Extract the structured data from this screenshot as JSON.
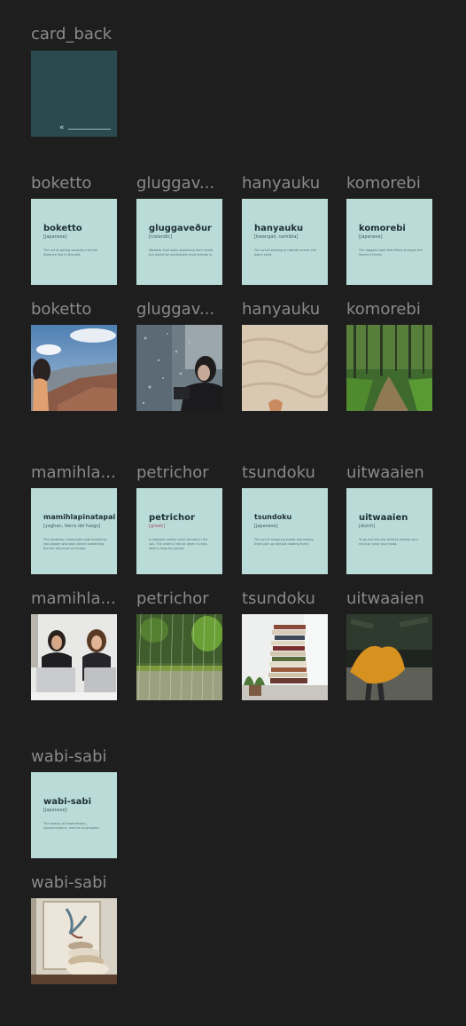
{
  "card_back": {
    "label": "card_back",
    "arrow": "«"
  },
  "rows": [
    {
      "labels": [
        "boketto",
        "gluggav...",
        "hanyauku",
        "komorebi"
      ],
      "cards": [
        {
          "word": "boketto",
          "origin": "[japanese]",
          "desc": "The act of gazing vacantly into the distance lost in thought."
        },
        {
          "word": "gluggaveður",
          "origin": "[icelandic]",
          "desc": "Weather that looks appealing from inside but would be unpleasant once outside in."
        },
        {
          "word": "hanyauku",
          "origin": "[kwangali, namibia]",
          "desc": "The act of walking on tiptoes across the warm sand."
        },
        {
          "word": "komorebi",
          "origin": "[japanese]",
          "desc": "The dappled light that filters through the leaves of trees."
        }
      ],
      "photo_labels": [
        "boketto",
        "gluggav...",
        "hanyauku",
        "komorebi"
      ]
    },
    {
      "labels": [
        "mamihla...",
        "petrichor",
        "tsundoku",
        "uitwaaien"
      ],
      "cards": [
        {
          "word": "mamihlapinatapai",
          "origin": "[yaghan, tierra del fuego]",
          "desc": "The wordless, meaningful look shared by two people who both desire something but are reluctant to initiate."
        },
        {
          "word": "petrichor",
          "origin": "[greek]",
          "desc": "A pleasant earthy scent formed in the soil. The smell in the air when it rains after a long dry period."
        },
        {
          "word": "tsundoku",
          "origin": "[japanese]",
          "desc": "The act of acquiring books and letting them pile up without reading them."
        },
        {
          "word": "uitwaaien",
          "origin": "[dutch]",
          "desc": "To go out into the wind to refresh your mind or clear your head."
        }
      ],
      "photo_labels": [
        "mamihla...",
        "petrichor",
        "tsundoku",
        "uitwaaien"
      ]
    },
    {
      "labels": [
        "wabi-sabi"
      ],
      "cards": [
        {
          "word": "wabi-sabi",
          "origin": "[japanese]",
          "desc": "The beauty of imperfection, impermanence, and the incomplete."
        }
      ],
      "photo_labels": [
        "wabi-sabi"
      ]
    }
  ],
  "colors": {
    "background": "#1e1e1e",
    "card": "#b9dcd9",
    "card_back": "#2a4a4f",
    "label": "#8a8a8a"
  }
}
